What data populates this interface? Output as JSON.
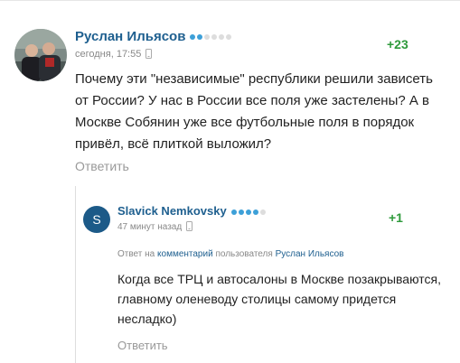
{
  "comments": [
    {
      "author": "Руслан Ильясов",
      "time": "сегодня, 17:55",
      "score": "+23",
      "text": "Почему эти \"независимые\" республики решили зависеть от России? У нас в России все поля уже застелены? А в Москве Собянин уже все футбольные поля в порядок привёл, всё плиткой выложил?",
      "reply_label": "Ответить",
      "rating_dots": {
        "filled": 2,
        "total": 6
      },
      "device_icon": "mobile-phone-icon"
    },
    {
      "author": "Slavick Nemkovsky",
      "avatar_letter": "S",
      "time": "47 минут назад",
      "score": "+1",
      "answer_prefix": "Ответ на",
      "answer_link": "комментарий",
      "answer_middle": "пользователя",
      "answer_user": "Руслан Ильясов",
      "text": "Когда все ТРЦ и автосалоны в Москве позакрываются, главному оленеводу столицы самому придется несладко)",
      "reply_label": "Ответить",
      "rating_dots": {
        "filled": 4,
        "total": 5
      },
      "device_icon": "mobile-phone-icon"
    }
  ],
  "colors": {
    "author": "#1e5f8f",
    "score": "#2e9a3b",
    "dot_filled": "#3da0d8",
    "dot_empty": "#dddddd",
    "avatar_letter_bg": "#1c5a88",
    "muted": "#999999"
  }
}
